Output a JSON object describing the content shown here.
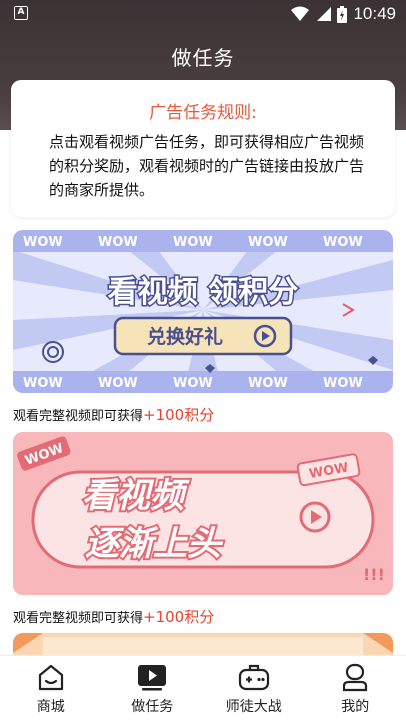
{
  "status": {
    "time": "10:49",
    "notification_glyph": "A"
  },
  "header": {
    "title": "做任务"
  },
  "rules": {
    "title": "广告任务规则:",
    "body": "点击观看视频广告任务，即可获得相应广告视频的积分奖励，观看视频时的广告链接由投放广告的商家所提供。"
  },
  "banners": [
    {
      "wow": "WOW",
      "headline": "看视频 领积分",
      "button": "兑换好礼",
      "caption_prefix": "观看完整视频即可获得",
      "caption_reward": "+100积分"
    },
    {
      "wow": "WOW",
      "headline_line1": "看视频",
      "headline_line2": "逐渐上头",
      "caption_prefix": "观看完整视频即可获得",
      "caption_reward": "+100积分"
    }
  ],
  "tabs": [
    {
      "label": "商城",
      "icon": "home-icon"
    },
    {
      "label": "做任务",
      "icon": "play-icon"
    },
    {
      "label": "师徒大战",
      "icon": "gamepad-icon"
    },
    {
      "label": "我的",
      "icon": "user-icon"
    }
  ],
  "colors": {
    "accent": "#e8583a",
    "reward": "#e8432e",
    "header_bg": "#3a3234"
  }
}
